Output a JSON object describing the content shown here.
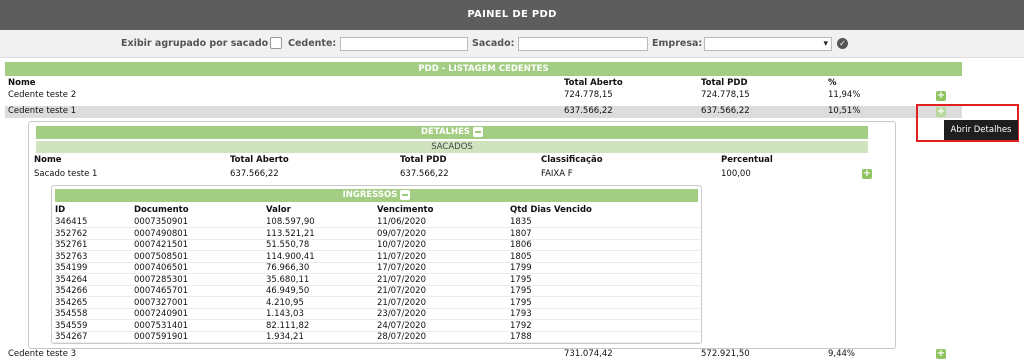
{
  "header": {
    "title": "PAINEL DE PDD"
  },
  "filters": {
    "group_label": "Exibir agrupado por sacado",
    "cedente_label": "Cedente:",
    "cedente_value": "",
    "sacado_label": "Sacado:",
    "sacado_value": "",
    "empresa_label": "Empresa:",
    "empresa_value": ""
  },
  "listing": {
    "title": "PDD - LISTAGEM CEDENTES",
    "columns": [
      "Nome",
      "Total Aberto",
      "Total PDD",
      "%"
    ],
    "rows": [
      {
        "nome": "Cedente teste 2",
        "total_aberto": "724.778,15",
        "total_pdd": "724.778,15",
        "pct": "11,94%"
      },
      {
        "nome": "Cedente teste 1",
        "total_aberto": "637.566,22",
        "total_pdd": "637.566,22",
        "pct": "10,51%"
      },
      {
        "nome": "Cedente teste 3",
        "total_aberto": "731.074,42",
        "total_pdd": "572.921,50",
        "pct": "9,44%"
      }
    ]
  },
  "details": {
    "title": "DETALHES",
    "subtitle": "SACADOS",
    "columns": [
      "Nome",
      "Total Aberto",
      "Total PDD",
      "Classificação",
      "Percentual"
    ],
    "row": {
      "nome": "Sacado teste 1",
      "total_aberto": "637.566,22",
      "total_pdd": "637.566,22",
      "classificacao": "FAIXA F",
      "percentual": "100,00"
    }
  },
  "ingressos": {
    "title": "INGRESSOS",
    "columns": [
      "ID",
      "Documento",
      "Valor",
      "Vencimento",
      "Qtd Dias Vencido"
    ],
    "rows": [
      [
        "346415",
        "0007350901",
        "108.597,90",
        "11/06/2020",
        "1835"
      ],
      [
        "352762",
        "0007490801",
        "113.521,21",
        "09/07/2020",
        "1807"
      ],
      [
        "352761",
        "0007421501",
        "51.550,78",
        "10/07/2020",
        "1806"
      ],
      [
        "352763",
        "0007508501",
        "114.900,41",
        "11/07/2020",
        "1805"
      ],
      [
        "354199",
        "0007406501",
        "76.966,30",
        "17/07/2020",
        "1799"
      ],
      [
        "354264",
        "0007285301",
        "35.680,11",
        "21/07/2020",
        "1795"
      ],
      [
        "354266",
        "0007465701",
        "46.949,50",
        "21/07/2020",
        "1795"
      ],
      [
        "354265",
        "0007327001",
        "4.210,95",
        "21/07/2020",
        "1795"
      ],
      [
        "354558",
        "0007240901",
        "1.143,03",
        "23/07/2020",
        "1793"
      ],
      [
        "354559",
        "0007531401",
        "82.111,82",
        "24/07/2020",
        "1792"
      ],
      [
        "354267",
        "0007591901",
        "1.934,21",
        "28/07/2020",
        "1788"
      ]
    ]
  },
  "tooltip": {
    "text": "Abrir Detalhes"
  },
  "icons": {
    "plus": "plus-icon",
    "minus": "minus-icon",
    "submit": "check-circle-icon",
    "dropdown": "chevron-down-icon"
  },
  "colors": {
    "topbar": "#5d5d5d",
    "green": "#a2cd82",
    "light_green": "#cfe3bf",
    "selected_row": "#dcdcdc",
    "highlight": "#e02020"
  }
}
